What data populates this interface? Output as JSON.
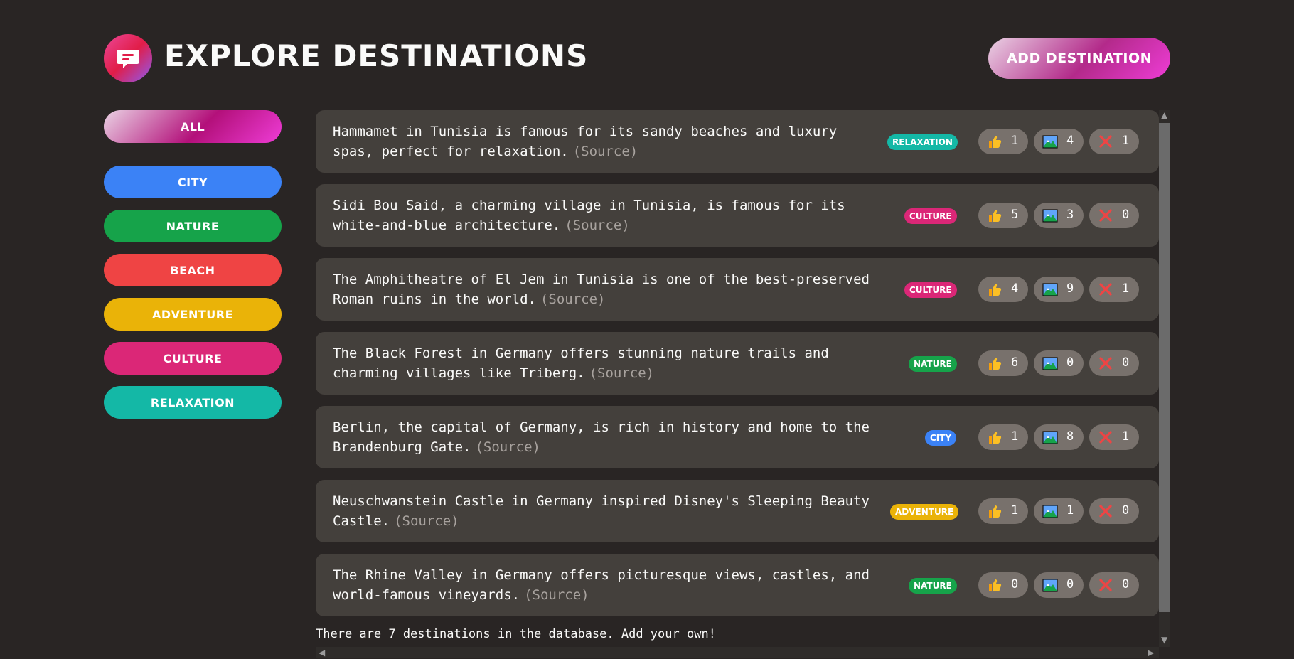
{
  "header": {
    "title": "Explore Destinations",
    "add_button": "Add Destination"
  },
  "categories": [
    {
      "label": "All",
      "color": "gradient"
    },
    {
      "label": "City",
      "color": "#3b82f6"
    },
    {
      "label": "Nature",
      "color": "#16a34a"
    },
    {
      "label": "Beach",
      "color": "#ef4444"
    },
    {
      "label": "Adventure",
      "color": "#eab308"
    },
    {
      "label": "Culture",
      "color": "#db2777"
    },
    {
      "label": "Relaxation",
      "color": "#14b8a6"
    }
  ],
  "facts": [
    {
      "text": "Hammamet in Tunisia is famous for its sandy beaches and luxury spas, perfect for relaxation.",
      "source": "(Source)",
      "tag": "Relaxation",
      "tag_color": "#14b8a6",
      "likes": "1",
      "mindblowing": "4",
      "false": "1"
    },
    {
      "text": "Sidi Bou Said, a charming village in Tunisia, is famous for its white-and-blue architecture.",
      "source": "(Source)",
      "tag": "Culture",
      "tag_color": "#db2777",
      "likes": "5",
      "mindblowing": "3",
      "false": "0"
    },
    {
      "text": "The Amphitheatre of El Jem in Tunisia is one of the best-preserved Roman ruins in the world.",
      "source": "(Source)",
      "tag": "Culture",
      "tag_color": "#db2777",
      "likes": "4",
      "mindblowing": "9",
      "false": "1"
    },
    {
      "text": "The Black Forest in Germany offers stunning nature trails and charming villages like Triberg.",
      "source": "(Source)",
      "tag": "Nature",
      "tag_color": "#16a34a",
      "likes": "6",
      "mindblowing": "0",
      "false": "0"
    },
    {
      "text": "Berlin, the capital of Germany, is rich in history and home to the Brandenburg Gate.",
      "source": "(Source)",
      "tag": "City",
      "tag_color": "#3b82f6",
      "likes": "1",
      "mindblowing": "8",
      "false": "1"
    },
    {
      "text": "Neuschwanstein Castle in Germany inspired Disney's Sleeping Beauty Castle.",
      "source": "(Source)",
      "tag": "Adventure",
      "tag_color": "#eab308",
      "likes": "1",
      "mindblowing": "1",
      "false": "0"
    },
    {
      "text": "The Rhine Valley in Germany offers picturesque views, castles, and world-famous vineyards.",
      "source": "(Source)",
      "tag": "Nature",
      "tag_color": "#16a34a",
      "likes": "0",
      "mindblowing": "0",
      "false": "0"
    }
  ],
  "footer_text": "There are 7 destinations in the database. Add your own!",
  "icons": {
    "like": "thumbs-up-icon",
    "mindblowing": "mountain-icon",
    "false": "red-x-icon",
    "logo": "chat-bubble-icon"
  }
}
